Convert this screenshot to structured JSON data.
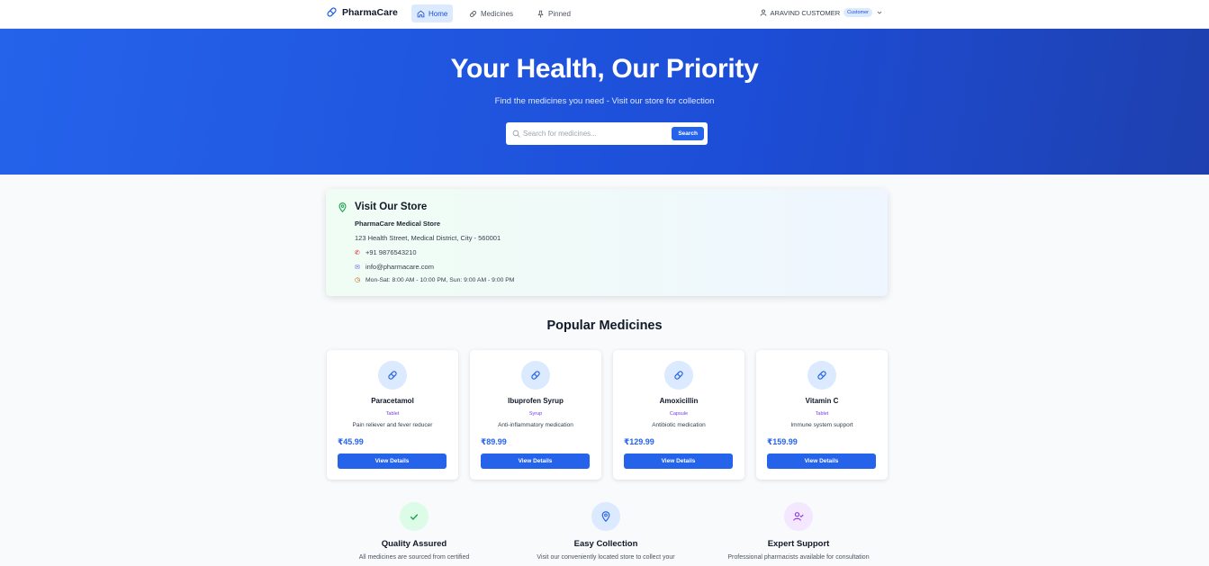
{
  "nav": {
    "brand": "PharmaCare",
    "links": [
      {
        "label": "Home",
        "icon": "home-icon",
        "active": true
      },
      {
        "label": "Medicines",
        "icon": "pill-icon",
        "active": false
      },
      {
        "label": "Pinned",
        "icon": "pin-icon",
        "active": false
      }
    ],
    "user_name": "ARAVIND CUSTOMER",
    "user_role": "Customer"
  },
  "hero": {
    "title": "Your Health, Our Priority",
    "subtitle": "Find the medicines you need - Visit our store for collection",
    "search_placeholder": "Search for medicines...",
    "search_button": "Search"
  },
  "store": {
    "heading": "Visit Our Store",
    "name": "PharmaCare Medical Store",
    "address": "123 Health Street, Medical District, City - 560001",
    "phone": "+91 9876543210",
    "email": "info@pharmacare.com",
    "hours": "Mon-Sat: 8:00 AM - 10:00 PM, Sun: 9:00 AM - 9:00 PM"
  },
  "popular": {
    "title": "Popular Medicines",
    "button_label": "View Details",
    "items": [
      {
        "name": "Paracetamol",
        "type": "Tablet",
        "description": "Pain reliever and fever reducer",
        "price": "₹45.99"
      },
      {
        "name": "Ibuprofen Syrup",
        "type": "Syrup",
        "description": "Anti-inflammatory medication",
        "price": "₹89.99"
      },
      {
        "name": "Amoxicillin",
        "type": "Capsule",
        "description": "Antibiotic medication",
        "price": "₹129.99"
      },
      {
        "name": "Vitamin C",
        "type": "Tablet",
        "description": "Immune system support",
        "price": "₹159.99"
      }
    ]
  },
  "features": [
    {
      "title": "Quality Assured",
      "description": "All medicines are sourced from certified",
      "icon": "check-icon",
      "color": "#dcfce7"
    },
    {
      "title": "Easy Collection",
      "description": "Visit our conveniently located store to collect your",
      "icon": "location-pin-icon",
      "color": "#dbeafe"
    },
    {
      "title": "Expert Support",
      "description": "Professional pharmacists available for consultation",
      "icon": "user-check-icon",
      "color": "#f3e8ff"
    }
  ],
  "colors": {
    "primary": "#2563eb",
    "accent_purple": "#7c3aed"
  }
}
